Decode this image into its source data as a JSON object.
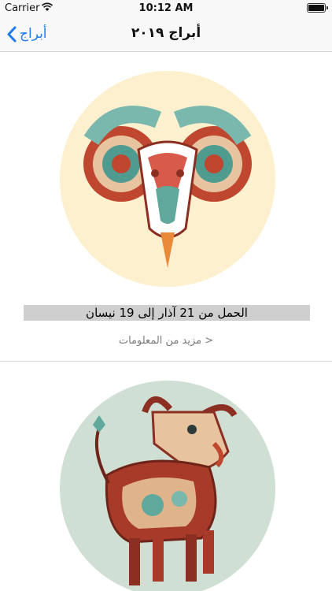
{
  "status_bar": {
    "carrier": "Carrier",
    "time": "10:12 AM"
  },
  "nav": {
    "back_label": "أبراج",
    "title": "أبراج ٢٠١٩"
  },
  "colors": {
    "accent": "#1e7cf2",
    "label_bg": "#cfcfcf",
    "aries_circle": "#fdf0cf",
    "taurus_circle": "#cfdfd3"
  },
  "cards": [
    {
      "icon": "aries-ram-icon",
      "label": "الحمل من 21 آذار إلى 19 نيسان",
      "more": "مزيد من المعلومات >"
    },
    {
      "icon": "taurus-bull-icon"
    }
  ]
}
